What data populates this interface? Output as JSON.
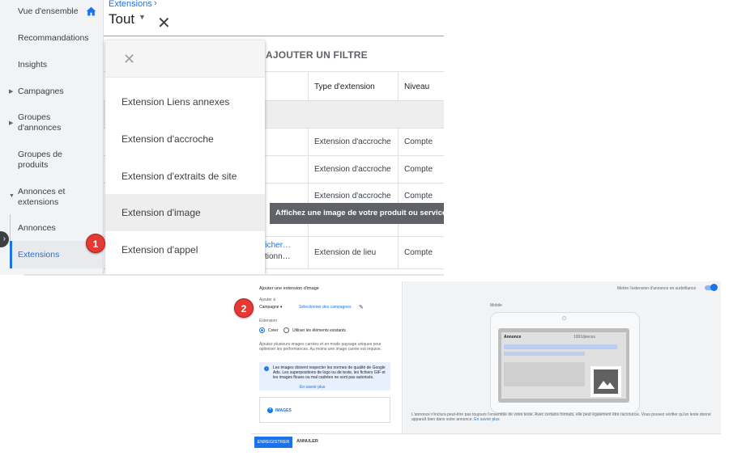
{
  "sidebar": {
    "items": [
      {
        "label": "Vue d'ensemble"
      },
      {
        "label": "Recommandations"
      },
      {
        "label": "Insights"
      },
      {
        "label": "Campagnes"
      },
      {
        "label": "Groupes d'annonces"
      },
      {
        "label": "Groupes de produits"
      },
      {
        "label": "Annonces et extensions"
      },
      {
        "label": "Annonces"
      },
      {
        "label": "Extensions"
      }
    ]
  },
  "header": {
    "breadcrumb": "Extensions",
    "filter_value": "Tout",
    "add_filter": "AJOUTER UN FILTRE"
  },
  "table": {
    "columns": [
      "Type d'extension",
      "Niveau"
    ],
    "rows": [
      {
        "type": "Extension d'accroche",
        "level": "Compte"
      },
      {
        "type": "Extension d'accroche",
        "level": "Compte"
      },
      {
        "type": "Extension d'accroche",
        "level": "Compte"
      },
      {
        "type": "Extension de lieu",
        "level": "Compte"
      }
    ],
    "partial_link_line1": "fficher…",
    "partial_link_line2": "ctionn…"
  },
  "dropdown": {
    "items": [
      {
        "label": "Extension Liens annexes"
      },
      {
        "label": "Extension d'accroche"
      },
      {
        "label": "Extension d'extraits de site"
      },
      {
        "label": "Extension d'image"
      },
      {
        "label": "Extension d'appel"
      }
    ],
    "highlighted_index": 3
  },
  "tooltip": "Affichez une image de votre produit ou service",
  "badges": [
    "1",
    "2"
  ],
  "form": {
    "title": "Ajouter une extension d'image",
    "add_to_label": "Ajouter à",
    "add_to_value": "Campagne",
    "select_campaigns": "Sélectionner des campagnes",
    "extension_label": "Extension",
    "radio_create": "Créer",
    "radio_existing": "Utiliser les éléments existants",
    "help_text": "Ajoutez plusieurs images carrées et en mode paysage uniques pour optimiser les performances. Au moins une image carrée est requise.",
    "info_text": "Les images doivent respecter les normes de qualité de Google Ads. Les superpositions de logo ou de texte, les fichiers GIF et les images floues ou mal cadrées ne sont pas autorisés.",
    "info_link": "En savoir plus",
    "images_button": "IMAGES"
  },
  "preview": {
    "toggle_label": "Mettre l'extension d'annonce en surbrillance",
    "device_label": "Mobile",
    "ad_label": "Annonce",
    "ad_url_tail": "1001/pieces",
    "disclaimer": "L'annonce n'inclura peut-être pas toujours l'ensemble de votre texte. Avec certains formats, elle peut également être raccourcie. Vous pouvez vérifier qu'un texte donné apparaît bien dans votre annonce.",
    "disclaimer_link": "En savoir plus"
  },
  "footer": {
    "save": "ENREGISTRER",
    "cancel": "ANNULER"
  }
}
